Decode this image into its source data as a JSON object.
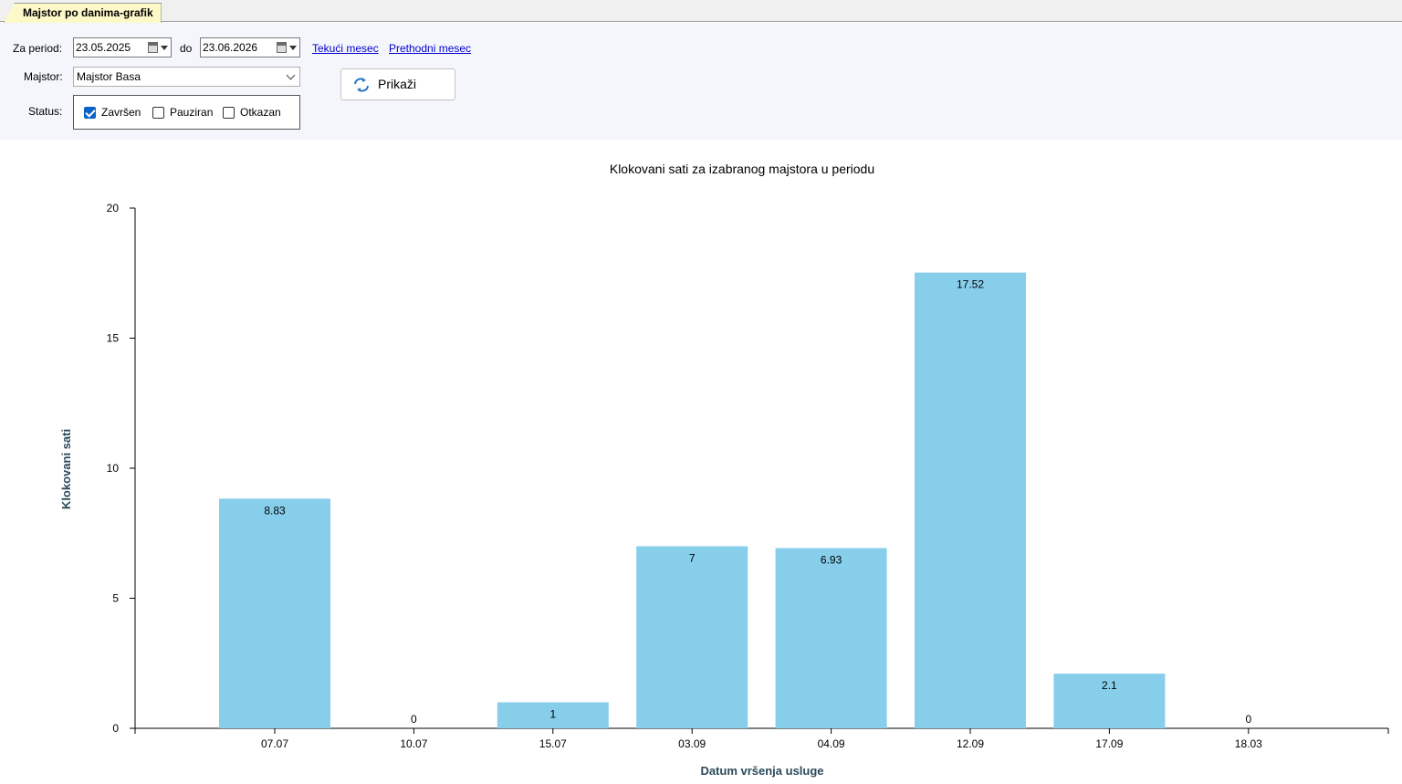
{
  "tab": {
    "label": "Majstor po danima-grafik"
  },
  "filters": {
    "period_label": "Za period:",
    "date_from": "23.05.2025",
    "to_label": "do",
    "date_to": "23.06.2026",
    "link_current": "Tekući mesec",
    "link_previous": "Prethodni mesec",
    "majstor_label": "Majstor:",
    "majstor_value": "Majstor Basa",
    "status_label": "Status:",
    "statuses": [
      {
        "label": "Završen",
        "checked": true
      },
      {
        "label": "Pauziran",
        "checked": false
      },
      {
        "label": "Otkazan",
        "checked": false
      }
    ],
    "show_button": "Prikaži"
  },
  "colors": {
    "bar": "#87ceeb",
    "axis_label": "#2b4a5a",
    "link": "#0000cc",
    "accent": "#0a64c8"
  },
  "chart_data": {
    "type": "bar",
    "title": "Klokovani sati za izabranog majstora u periodu",
    "xlabel": "Datum vršenja usluge",
    "ylabel": "Klokovani sati",
    "categories": [
      "07.07",
      "10.07",
      "15.07",
      "03.09",
      "04.09",
      "12.09",
      "17.09",
      "18.03"
    ],
    "values": [
      8.83,
      0,
      1,
      7,
      6.93,
      17.52,
      2.1,
      0
    ],
    "data_labels": [
      "8.83",
      "0",
      "1",
      "7",
      "6.93",
      "17.52",
      "2.1",
      "0"
    ],
    "ylim": [
      0,
      20
    ],
    "yticks": [
      0,
      5,
      10,
      15,
      20
    ],
    "grid": false,
    "legend": "none"
  }
}
